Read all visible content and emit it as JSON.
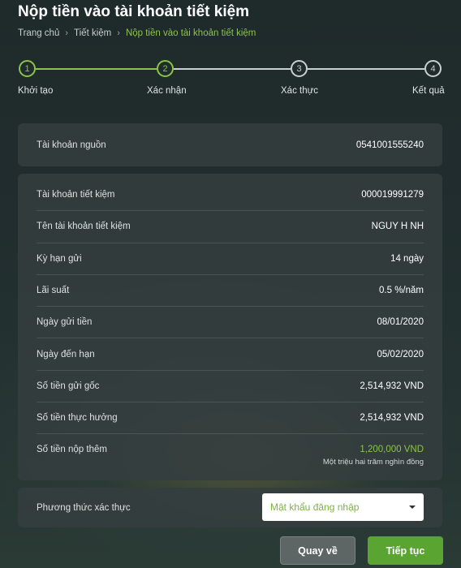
{
  "page": {
    "title": "Nộp tiền vào tài khoản tiết kiệm"
  },
  "breadcrumb": {
    "items": [
      "Trang chủ",
      "Tiết kiệm"
    ],
    "current": "Nộp tiền vào tài khoản tiết kiệm",
    "separator": "›"
  },
  "stepper": {
    "steps": [
      {
        "number": "1",
        "label": "Khởi tạo",
        "state": "done"
      },
      {
        "number": "2",
        "label": "Xác nhận",
        "state": "current"
      },
      {
        "number": "3",
        "label": "Xác thực",
        "state": "pending"
      },
      {
        "number": "4",
        "label": "Kết quả",
        "state": "pending"
      }
    ]
  },
  "source": {
    "label": "Tài khoản nguồn",
    "value": "0541001555240"
  },
  "details": [
    {
      "label": "Tài khoản tiết kiệm",
      "value": "000019991279"
    },
    {
      "label": "Tên tài khoản tiết kiệm",
      "value": "NGUY H NH"
    },
    {
      "label": "Kỳ hạn gửi",
      "value": "14 ngày"
    },
    {
      "label": "Lãi suất",
      "value": "0.5 %/năm"
    },
    {
      "label": "Ngày gửi tiền",
      "value": "08/01/2020"
    },
    {
      "label": "Ngày đến hạn",
      "value": "05/02/2020"
    },
    {
      "label": "Số tiền gửi gốc",
      "value": "2,514,932 VND"
    },
    {
      "label": "Số tiền thực hưởng",
      "value": "2,514,932 VND"
    }
  ],
  "extra": {
    "label": "Số tiền nộp thêm",
    "value": "1,200,000 VND",
    "words": "Một triệu hai trăm nghìn đồng"
  },
  "auth": {
    "label": "Phương thức xác thực",
    "selected": "Mật khẩu đăng nhập"
  },
  "buttons": {
    "back": "Quay về",
    "next": "Tiếp tục"
  },
  "colors": {
    "accent": "#8bc34a",
    "primary_button": "#5aa431"
  }
}
